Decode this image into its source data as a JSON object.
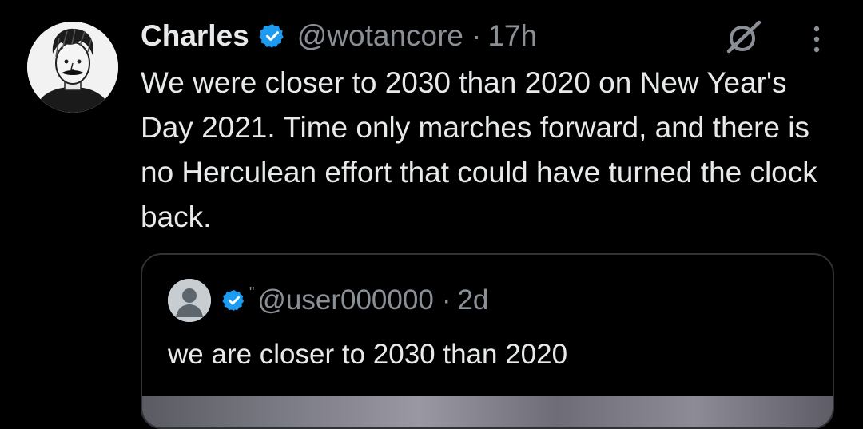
{
  "tweet": {
    "display_name": "Charles",
    "handle": "@wotancore",
    "separator": "·",
    "time": "17h",
    "text": "We were closer to 2030 than 2020 on New Year's Day 2021. Time only marches forward, and there is no Herculean effort that could have turned the clock back.",
    "avatar_icon": "sketch-portrait-avatar",
    "verified_icon": "verified-badge-icon",
    "grok_icon": "grok-slash-icon",
    "more_icon": "more-vertical-icon"
  },
  "quote": {
    "mark": "\"",
    "handle": "@user000000",
    "separator": "·",
    "time": "2d",
    "text": "we are closer to 2030 than 2020",
    "avatar_icon": "default-user-avatar",
    "verified_icon": "verified-badge-icon"
  },
  "colors": {
    "background": "#000000",
    "text_primary": "#e7e9ea",
    "text_secondary": "#8b9096",
    "verified_blue": "#1d9bf0",
    "border": "#2f3336"
  }
}
